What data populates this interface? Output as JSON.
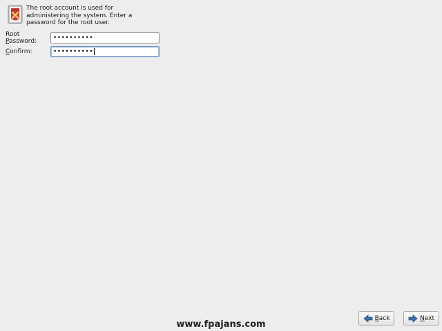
{
  "header": {
    "description": "The root account is used for administering the system.  Enter a password for the root user.",
    "icon": "root-user-icon"
  },
  "form": {
    "root_password": {
      "label_prefix": "Root ",
      "label_mnemonic": "P",
      "label_rest": "assword:",
      "value": "••••••••••"
    },
    "confirm": {
      "label_mnemonic": "C",
      "label_rest": "onfirm:",
      "value": "••••••••••"
    }
  },
  "buttons": {
    "back": {
      "mnemonic": "B",
      "rest": "ack",
      "icon": "arrow-left-icon"
    },
    "next": {
      "mnemonic": "N",
      "rest": "ext",
      "icon": "arrow-right-icon"
    }
  },
  "watermark": "www.fpajans.com"
}
